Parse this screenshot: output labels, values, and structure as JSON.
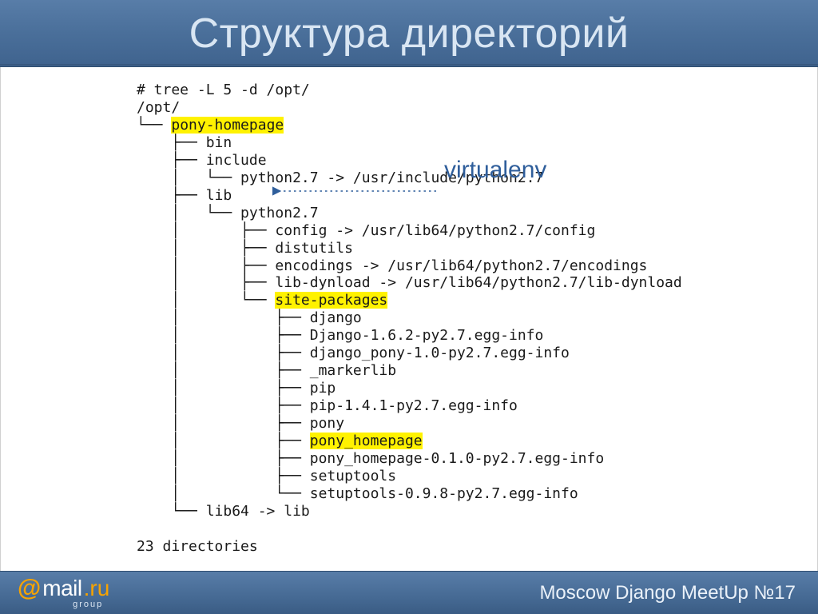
{
  "header": {
    "title": "Структура директорий"
  },
  "callout": {
    "label": "virtualenv"
  },
  "tree": {
    "cmd": "# tree -L 5 -d /opt/",
    "root": "/opt/",
    "l1": "└── ",
    "hl1": "pony-homepage",
    "l2": "    ├── bin",
    "l3": "    ├── include",
    "l4": "    │   └── python2.7 -> /usr/include/python2.7",
    "l5": "    ├── lib",
    "l6": "    │   └── python2.7",
    "l7": "    │       ├── config -> /usr/lib64/python2.7/config",
    "l8": "    │       ├── distutils",
    "l9": "    │       ├── encodings -> /usr/lib64/python2.7/encodings",
    "l10": "    │       ├── lib-dynload -> /usr/lib64/python2.7/lib-dynload",
    "l11": "    │       └── ",
    "hl2": "site-packages",
    "l12": "    │           ├── django",
    "l13": "    │           ├── Django-1.6.2-py2.7.egg-info",
    "l14": "    │           ├── django_pony-1.0-py2.7.egg-info",
    "l15": "    │           ├── _markerlib",
    "l16": "    │           ├── pip",
    "l17": "    │           ├── pip-1.4.1-py2.7.egg-info",
    "l18": "    │           ├── pony",
    "l19": "    │           ├── ",
    "hl3": "pony_homepage",
    "l20": "    │           ├── pony_homepage-0.1.0-py2.7.egg-info",
    "l21": "    │           ├── setuptools",
    "l22": "    │           └── setuptools-0.9.8-py2.7.egg-info",
    "l23": "    └── lib64 -> lib",
    "blank": "",
    "summary": "23 directories"
  },
  "footer": {
    "event": "Moscow Django MeetUp №17",
    "logo_at": "@",
    "logo_mail": "mail",
    "logo_dot_ru": ".ru",
    "logo_group": "group"
  }
}
